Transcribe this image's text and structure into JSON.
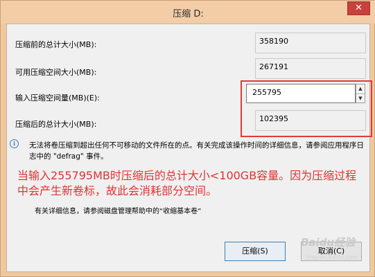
{
  "window": {
    "title": "压缩 D:",
    "close_label": "✕"
  },
  "fields": {
    "total_before": {
      "label": "压缩前的总计大小(MB):",
      "value": "358190"
    },
    "available": {
      "label": "可用压缩空间大小(MB):",
      "value": "267191"
    },
    "input": {
      "label": "输入压缩空间量(MB)(E):",
      "value": "255795",
      "spin_up": "▲",
      "spin_down": "▼"
    },
    "total_after": {
      "label": "压缩后的总计大小(MB):",
      "value": "102395"
    }
  },
  "info": {
    "icon": "info-icon",
    "icon_glyph": "i",
    "text": "无法将卷压缩到超出任何不可移动的文件所在的点。有关完成该操作时间的详细信息，请参阅应用程序日志中的 \"defrag\" 事件。"
  },
  "annotation": {
    "text": "当输入255795MB时压缩后的总计大小<100GB容量。因为压缩过程中会产生新卷标，故此会消耗部分空间。"
  },
  "help": {
    "text": "有关详细信息，请参阅磁盘管理帮助中的“收缩基本卷”"
  },
  "buttons": {
    "shrink": "压缩(S)",
    "cancel": "取消(C)"
  },
  "watermark": {
    "brand": "Baidu经验",
    "url": "jingyan.baidu.com"
  },
  "colors": {
    "title_bar": "#f3cda6",
    "close_button": "#c8413a",
    "annotation_red": "#e03232",
    "highlight_frame": "#e3393a",
    "info_icon": "#3b79c5"
  }
}
